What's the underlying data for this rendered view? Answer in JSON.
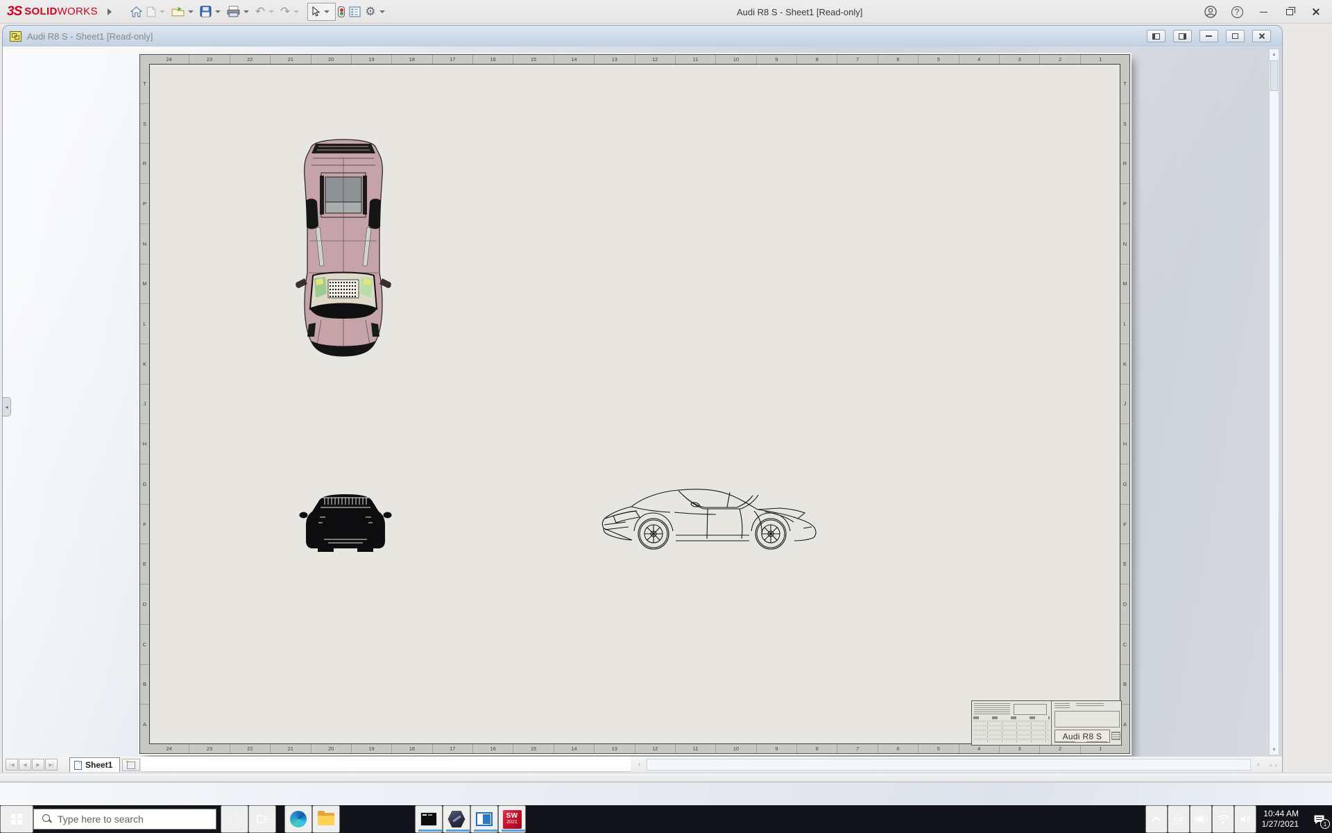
{
  "app": {
    "brand_mark": "3S",
    "brand_solid": "SOLID",
    "brand_works": "WORKS",
    "window_title": "Audi R8 S - Sheet1 [Read-only]"
  },
  "doc": {
    "title": "Audi R8 S - Sheet1 [Read-only]"
  },
  "sheet": {
    "column_zones": [
      "24",
      "23",
      "22",
      "21",
      "20",
      "19",
      "18",
      "17",
      "16",
      "15",
      "14",
      "13",
      "12",
      "11",
      "10",
      "9",
      "8",
      "7",
      "6",
      "5",
      "4",
      "3",
      "2",
      "1"
    ],
    "row_zones": [
      "T",
      "S",
      "R",
      "P",
      "N",
      "M",
      "L",
      "K",
      "J",
      "H",
      "G",
      "F",
      "E",
      "D",
      "C",
      "B",
      "A"
    ],
    "title_block": {
      "part_name": "Audi R8 S"
    }
  },
  "bottom": {
    "sheet_tab_label": "Sheet1"
  },
  "taskbar": {
    "search_placeholder": "Type here to search",
    "time": "10:44 AM",
    "date": "1/27/2021",
    "notification_badge": "1",
    "sw_label": "SW",
    "sw_year": "2021"
  },
  "colors": {
    "brand_red": "#d5001c",
    "taskbar_underline": "#5aa0dd",
    "paper": "#e7e6e0",
    "car_body_pink": "#c5a3a8"
  }
}
